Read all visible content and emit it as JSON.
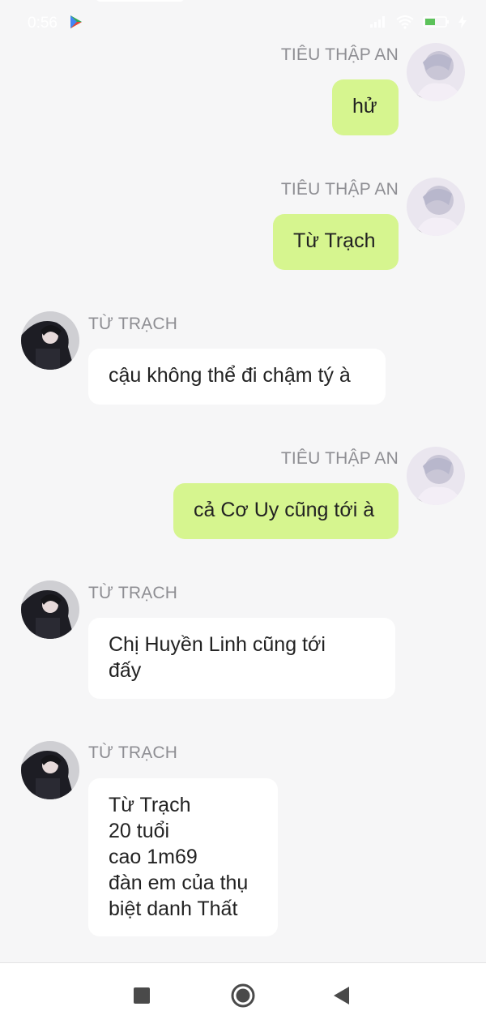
{
  "status_bar": {
    "time": "0:56",
    "icons": [
      "play-store-icon",
      "signal-icon",
      "wifi-icon",
      "battery-icon",
      "charging-icon"
    ],
    "battery_level": "6"
  },
  "colors": {
    "background": "#f6f6f7",
    "bubble_self": "#d6f58f",
    "bubble_other": "#ffffff",
    "name_text": "#8e8e93"
  },
  "messages": [
    {
      "sender": "TIÊU THẬP AN",
      "side": "right",
      "text": "hử"
    },
    {
      "sender": "TIÊU THẬP AN",
      "side": "right",
      "text": "Từ Trạch"
    },
    {
      "sender": "TỪ TRẠCH",
      "side": "left",
      "text": "cậu không thể đi chậm tý à"
    },
    {
      "sender": "TIÊU THẬP AN",
      "side": "right",
      "text": "cả Cơ Uy cũng tới à"
    },
    {
      "sender": "TỪ TRẠCH",
      "side": "left",
      "text": "Chị Huyền Linh cũng tới\nđấy"
    },
    {
      "sender": "TỪ TRẠCH",
      "side": "left",
      "text": "Từ Trạch\n20 tuổi\ncao 1m69\nđàn em của thụ\nbiệt danh Thất"
    }
  ],
  "nav_bar": {
    "buttons": [
      "recents-square-icon",
      "home-circle-icon",
      "back-triangle-icon"
    ]
  }
}
